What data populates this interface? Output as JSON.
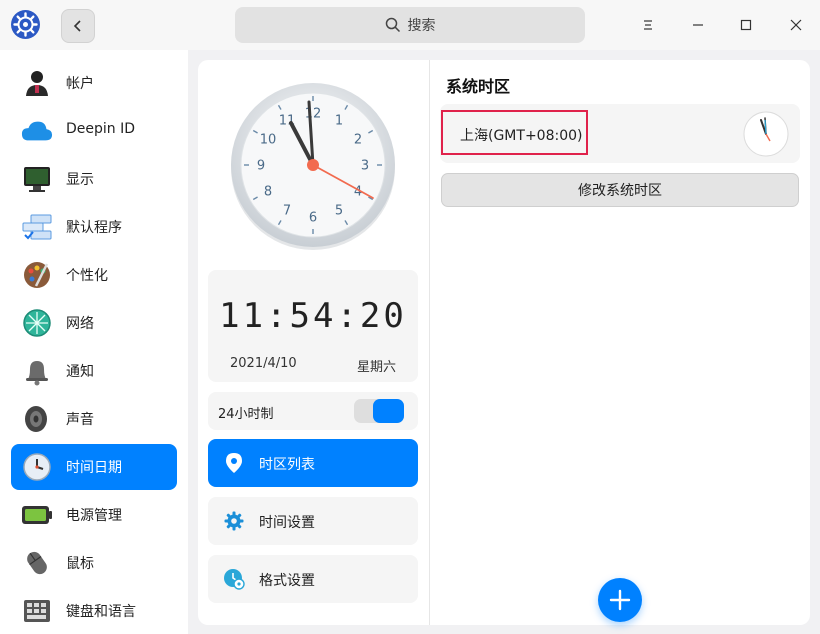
{
  "titlebar": {
    "search_placeholder": "搜索"
  },
  "sidebar": {
    "items": [
      {
        "label": "帐户",
        "icon": "user-icon"
      },
      {
        "label": "Deepin ID",
        "icon": "cloud-icon"
      },
      {
        "label": "显示",
        "icon": "monitor-icon"
      },
      {
        "label": "默认程序",
        "icon": "default-apps-icon"
      },
      {
        "label": "个性化",
        "icon": "palette-icon"
      },
      {
        "label": "网络",
        "icon": "network-icon"
      },
      {
        "label": "通知",
        "icon": "bell-icon"
      },
      {
        "label": "声音",
        "icon": "speaker-icon"
      },
      {
        "label": "时间日期",
        "icon": "clock-icon",
        "active": true
      },
      {
        "label": "电源管理",
        "icon": "battery-icon"
      },
      {
        "label": "鼠标",
        "icon": "mouse-icon"
      },
      {
        "label": "键盘和语言",
        "icon": "keyboard-icon"
      }
    ]
  },
  "clock_panel": {
    "analog_numbers": [
      "12",
      "1",
      "2",
      "3",
      "4",
      "5",
      "6",
      "7",
      "8",
      "9",
      "10",
      "11"
    ],
    "digital_time": "11:54:20",
    "date": "2021/4/10",
    "weekday": "星期六",
    "format_24h_label": "24小时制",
    "format_24h_enabled": true
  },
  "menu": {
    "items": [
      {
        "label": "时区列表",
        "icon": "location-pin-icon",
        "active": true
      },
      {
        "label": "时间设置",
        "icon": "gear-icon"
      },
      {
        "label": "格式设置",
        "icon": "clock-format-icon"
      }
    ]
  },
  "timezone": {
    "section_title": "系统时区",
    "current": "上海(GMT+08:00)",
    "change_button": "修改系统时区"
  },
  "colors": {
    "accent": "#0081ff",
    "highlight_border": "#e0224b",
    "second_hand": "#f26b4f"
  }
}
